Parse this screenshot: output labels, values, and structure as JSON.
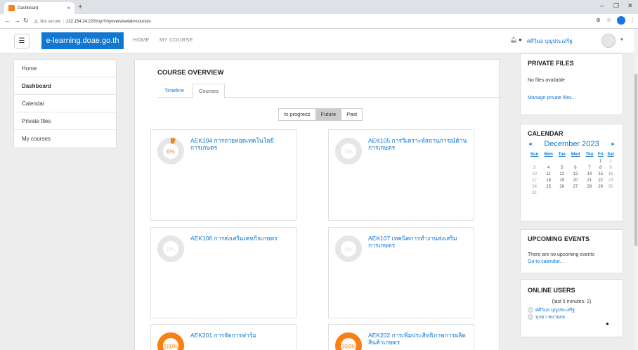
{
  "browser": {
    "tab_title": "Dashboard",
    "tab_close": "×",
    "new_tab": "+",
    "security": "Not secure",
    "url": "122.154.24.220/my/?myoverviewtab=courses",
    "minimize": "–",
    "restore": "❐",
    "close": "✕"
  },
  "navbar": {
    "brand": "e-learning.doae.go.th",
    "links": [
      "HOME",
      "MY COURSE"
    ],
    "user": "ศศิวิมล บุญประเสริฐ"
  },
  "leftnav": {
    "items": [
      "Home",
      "Dashboard",
      "Calendar",
      "Private files",
      "My courses"
    ],
    "active_index": 1
  },
  "overview": {
    "title": "COURSE OVERVIEW",
    "tabs": [
      "Timeline",
      "Courses"
    ],
    "filters": [
      "In progress",
      "Future",
      "Past"
    ],
    "selected_filter": 1,
    "courses": [
      {
        "name": "AEK104 การถ่ายทอดเทคโนโลยีการเกษตร",
        "progress_label": "6%",
        "progress": 6
      },
      {
        "name": "AEK105 การวิเคราะห์สถานการณ์ด้านการเกษตร",
        "progress_label": "0%",
        "progress": 0
      },
      {
        "name": "AEK106 การส่งเสริมเคหกิจเกษตร",
        "progress_label": "0%",
        "progress": 0
      },
      {
        "name": "AEK107 เทคนิคการทำงานส่งเสริมการเกษตร",
        "progress_label": "0%",
        "progress": 0
      },
      {
        "name": "AEK201 การจัดการฟาร์ม",
        "progress_label": "100%",
        "progress": 100
      },
      {
        "name": "AEK202 การเพิ่มประสิทธิภาพการผลิตสินค้าเกษตร",
        "progress_label": "100%",
        "progress": 100
      }
    ]
  },
  "private_files": {
    "title": "PRIVATE FILES",
    "empty": "No files available",
    "manage": "Manage private files..."
  },
  "calendar": {
    "title": "CALENDAR",
    "month": "December 2023",
    "prev": "◄",
    "next": "►",
    "days": [
      "Sun",
      "Mon",
      "Tue",
      "Wed",
      "Thu",
      "Fri",
      "Sat"
    ],
    "weeks": [
      [
        "",
        "",
        "",
        "",
        "",
        "1",
        "2"
      ],
      [
        "3",
        "4",
        "5",
        "6",
        "7",
        "8",
        "9"
      ],
      [
        "10",
        "11",
        "12",
        "13",
        "14",
        "15",
        "16"
      ],
      [
        "17",
        "18",
        "19",
        "20",
        "21",
        "22",
        "23"
      ],
      [
        "24",
        "25",
        "26",
        "27",
        "28",
        "29",
        "30"
      ],
      [
        "31",
        "",
        "",
        "",
        "",
        "",
        ""
      ]
    ]
  },
  "upcoming": {
    "title": "UPCOMING EVENTS",
    "text": "There are no upcoming events",
    "link": "Go to calendar..."
  },
  "online": {
    "title": "ONLINE USERS",
    "summary": "(last 5 minutes: 2)",
    "users": [
      "ศศิวิมล บุญประเสริฐ",
      "มุกดา หมายสม"
    ]
  },
  "colors": {
    "brand": "#1177d1",
    "progress": "#f98012",
    "progress_track": "#e6e6e6"
  }
}
